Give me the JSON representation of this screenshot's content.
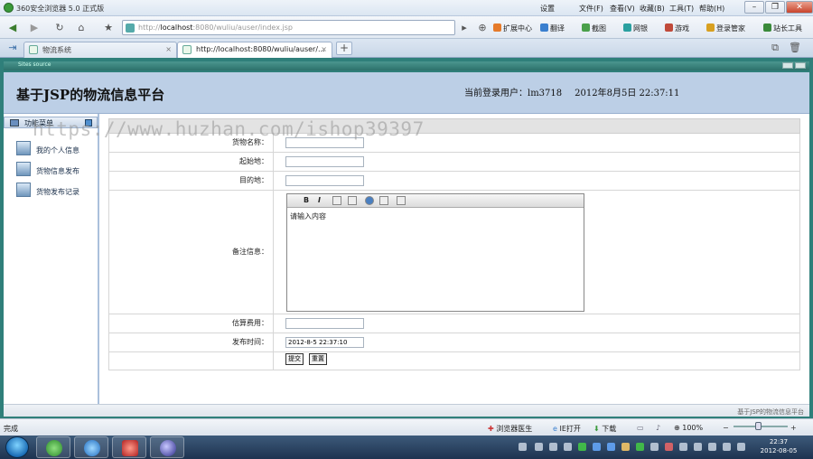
{
  "window": {
    "title": "360安全浏览器 5.0 正式版",
    "menu": [
      "设置",
      "文件(F)",
      "查看(V)",
      "收藏(B)",
      "工具(T)",
      "帮助(H)"
    ]
  },
  "address": {
    "grey": "http://",
    "host": "localhost",
    "rest": ":8080/wuliu/auser/index.jsp"
  },
  "toolbar": {
    "items": [
      "扩展中心",
      "翻译",
      "截图",
      "网银",
      "游戏",
      "登录管家",
      "站长工具"
    ]
  },
  "tabs": [
    {
      "label": "物流系统"
    },
    {
      "label": "http://localhost:8080/wuliu/auser/..."
    }
  ],
  "frame": {
    "title": "Sites source"
  },
  "header": {
    "site_title": "基于JSP的物流信息平台",
    "user_label": "当前登录用户：",
    "user_name": "lm3718",
    "datetime": "2012年8月5日  22:37:11"
  },
  "sidebar": {
    "heading": "功能菜单",
    "items": [
      {
        "label": "我的个人信息"
      },
      {
        "label": "货物信息发布"
      },
      {
        "label": "货物发布记录"
      }
    ]
  },
  "form": {
    "fields": [
      {
        "label": "货物名称：",
        "value": ""
      },
      {
        "label": "起始地：",
        "value": ""
      },
      {
        "label": "目的地：",
        "value": ""
      },
      {
        "label": "备注信息：",
        "value": "请输入内容"
      },
      {
        "label": "估算费用：",
        "value": ""
      },
      {
        "label": "发布时间：",
        "value": "2012-8-5 22:37:10"
      }
    ],
    "submit": "提交",
    "reset": "重置",
    "editor_bold": "B",
    "editor_italic": "I"
  },
  "watermark": "https://www.huzhan.com/ishop39397",
  "footer": {
    "text": "基于JSP的物流信息平台"
  },
  "statusbar": {
    "left": "完成",
    "items": [
      "浏览器医生",
      "IE打开",
      "下载",
      "100%"
    ]
  },
  "clock": {
    "time": "22:37",
    "date": "2012-08-05"
  }
}
